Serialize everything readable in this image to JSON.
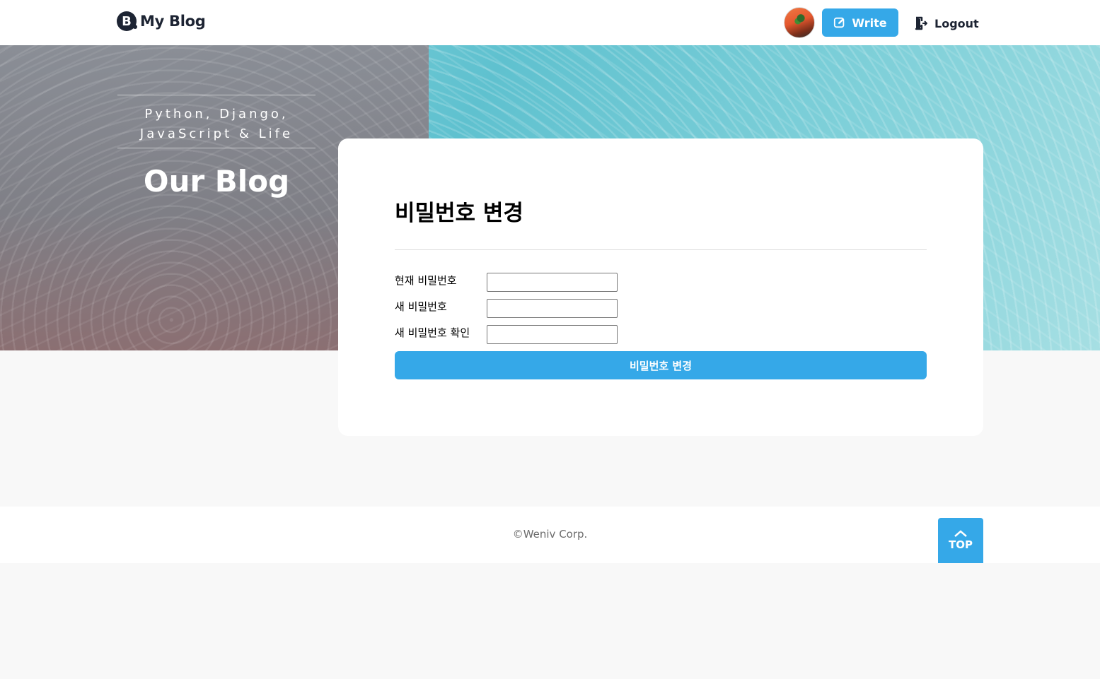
{
  "header": {
    "logo_mark": "B",
    "logo_text": "My Blog",
    "write_label": "Write",
    "logout_label": "Logout"
  },
  "hero": {
    "tagline_line1": "Python, Django,",
    "tagline_line2": "JavaScript & Life",
    "title": "Our Blog"
  },
  "form": {
    "title": "비밀번호 변경",
    "fields": [
      {
        "label": "현재 비밀번호",
        "value": ""
      },
      {
        "label": "새 비밀번호",
        "value": ""
      },
      {
        "label": "새 비밀번호 확인",
        "value": ""
      }
    ],
    "submit_label": "비밀번호 변경"
  },
  "footer": {
    "copyright": "©Weniv Corp.",
    "top_label": "TOP"
  },
  "colors": {
    "accent": "#35a8e8",
    "header_text": "#1d2433",
    "page_bg": "#f8f8f8"
  },
  "icons": {
    "logo": "logo-icon",
    "write": "edit-icon",
    "logout": "logout-icon",
    "top": "chevron-up-icon"
  }
}
